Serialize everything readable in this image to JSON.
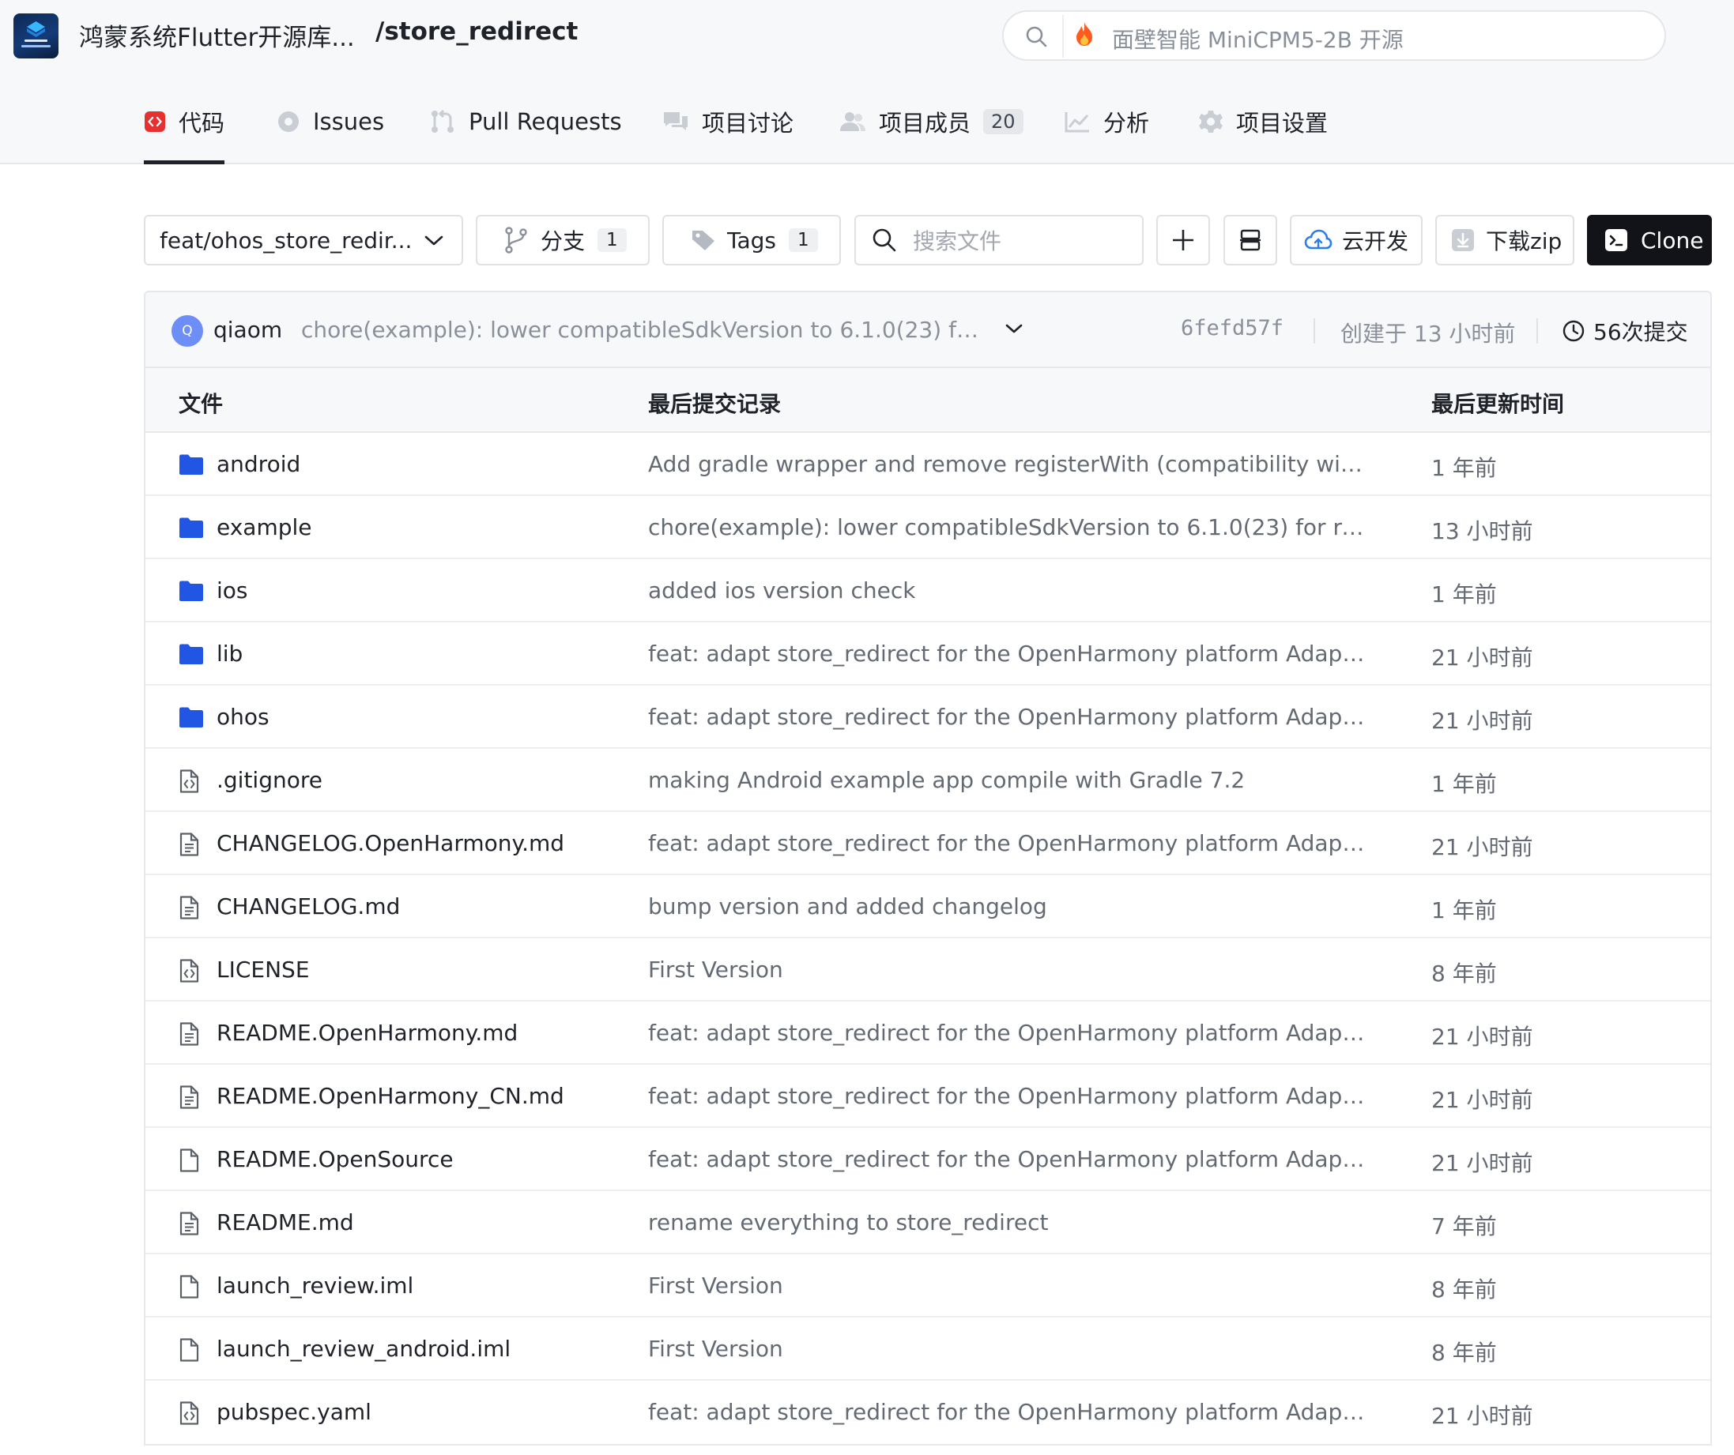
{
  "header": {
    "logo_icon": "harmony-flutter-logo",
    "repo_owner": "鸿蒙系统Flutter开源库...",
    "repo_name": "/store_redirect",
    "search": {
      "icon": "search-icon",
      "trending_icon": "fire-icon",
      "placeholder": "面壁智能 MiniCPM5-2B 开源"
    }
  },
  "nav": {
    "tabs": [
      {
        "label": "代码",
        "icon": "code-icon",
        "active": true
      },
      {
        "label": "Issues",
        "icon": "issue-icon"
      },
      {
        "label": "Pull Requests",
        "icon": "pull-request-icon"
      },
      {
        "label": "项目讨论",
        "icon": "discussion-icon"
      },
      {
        "label": "项目成员",
        "icon": "members-icon",
        "badge": "20"
      },
      {
        "label": "分析",
        "icon": "chart-icon"
      },
      {
        "label": "项目设置",
        "icon": "gear-icon"
      }
    ]
  },
  "toolbar": {
    "branch_select": "feat/ohos_store_redir...",
    "branches_label": "分支",
    "branches_count": "1",
    "tags_label": "Tags",
    "tags_count": "1",
    "file_search_placeholder": "搜索文件",
    "cloud_dev_label": "云开发",
    "download_label": "下载zip",
    "clone_label": "Clone"
  },
  "commit": {
    "avatar_letter": "Q",
    "author": "qiaom",
    "message": "chore(example): lower compatibleSdkVersion to 6.1.0(23) for re...",
    "hash": "6fefd57f",
    "created": "创建于 13 小时前",
    "count": "56次提交"
  },
  "table": {
    "headers": {
      "file": "文件",
      "last_commit": "最后提交记录",
      "updated": "最后更新时间"
    },
    "rows": [
      {
        "type": "folder",
        "name": "android",
        "message": "Add gradle wrapper and remove registerWith (compatibility with ne...",
        "time": "1 年前"
      },
      {
        "type": "folder",
        "name": "example",
        "message": "chore(example): lower compatibleSdkVersion to 6.1.0(23) for real-d...",
        "time": "13 小时前"
      },
      {
        "type": "folder",
        "name": "ios",
        "message": "added ios version check",
        "time": "1 年前"
      },
      {
        "type": "folder",
        "name": "lib",
        "message": "feat: adapt store_redirect for the OpenHarmony platform Adapt sto...",
        "time": "21 小时前"
      },
      {
        "type": "folder",
        "name": "ohos",
        "message": "feat: adapt store_redirect for the OpenHarmony platform Adapt sto...",
        "time": "21 小时前"
      },
      {
        "type": "code",
        "name": ".gitignore",
        "message": "making Android example app compile with Gradle 7.2",
        "time": "1 年前"
      },
      {
        "type": "text",
        "name": "CHANGELOG.OpenHarmony.md",
        "message": "feat: adapt store_redirect for the OpenHarmony platform Adapt sto...",
        "time": "21 小时前"
      },
      {
        "type": "text",
        "name": "CHANGELOG.md",
        "message": "bump version and added changelog",
        "time": "1 年前"
      },
      {
        "type": "code",
        "name": "LICENSE",
        "message": "First Version",
        "time": "8 年前"
      },
      {
        "type": "text",
        "name": "README.OpenHarmony.md",
        "message": "feat: adapt store_redirect for the OpenHarmony platform Adapt sto...",
        "time": "21 小时前"
      },
      {
        "type": "text",
        "name": "README.OpenHarmony_CN.md",
        "message": "feat: adapt store_redirect for the OpenHarmony platform Adapt sto...",
        "time": "21 小时前"
      },
      {
        "type": "blank",
        "name": "README.OpenSource",
        "message": "feat: adapt store_redirect for the OpenHarmony platform Adapt sto...",
        "time": "21 小时前"
      },
      {
        "type": "text",
        "name": "README.md",
        "message": "rename everything to store_redirect",
        "time": "7 年前"
      },
      {
        "type": "blank",
        "name": "launch_review.iml",
        "message": "First Version",
        "time": "8 年前"
      },
      {
        "type": "blank",
        "name": "launch_review_android.iml",
        "message": "First Version",
        "time": "8 年前"
      },
      {
        "type": "code",
        "name": "pubspec.yaml",
        "message": "feat: adapt store_redirect for the OpenHarmony platform Adapt sto...",
        "time": "21 小时前"
      }
    ]
  },
  "colors": {
    "folder": "#2156e4",
    "code_tab_icon": "#e5312f",
    "clone_bg": "#111318",
    "muted_text": "#646a73"
  }
}
